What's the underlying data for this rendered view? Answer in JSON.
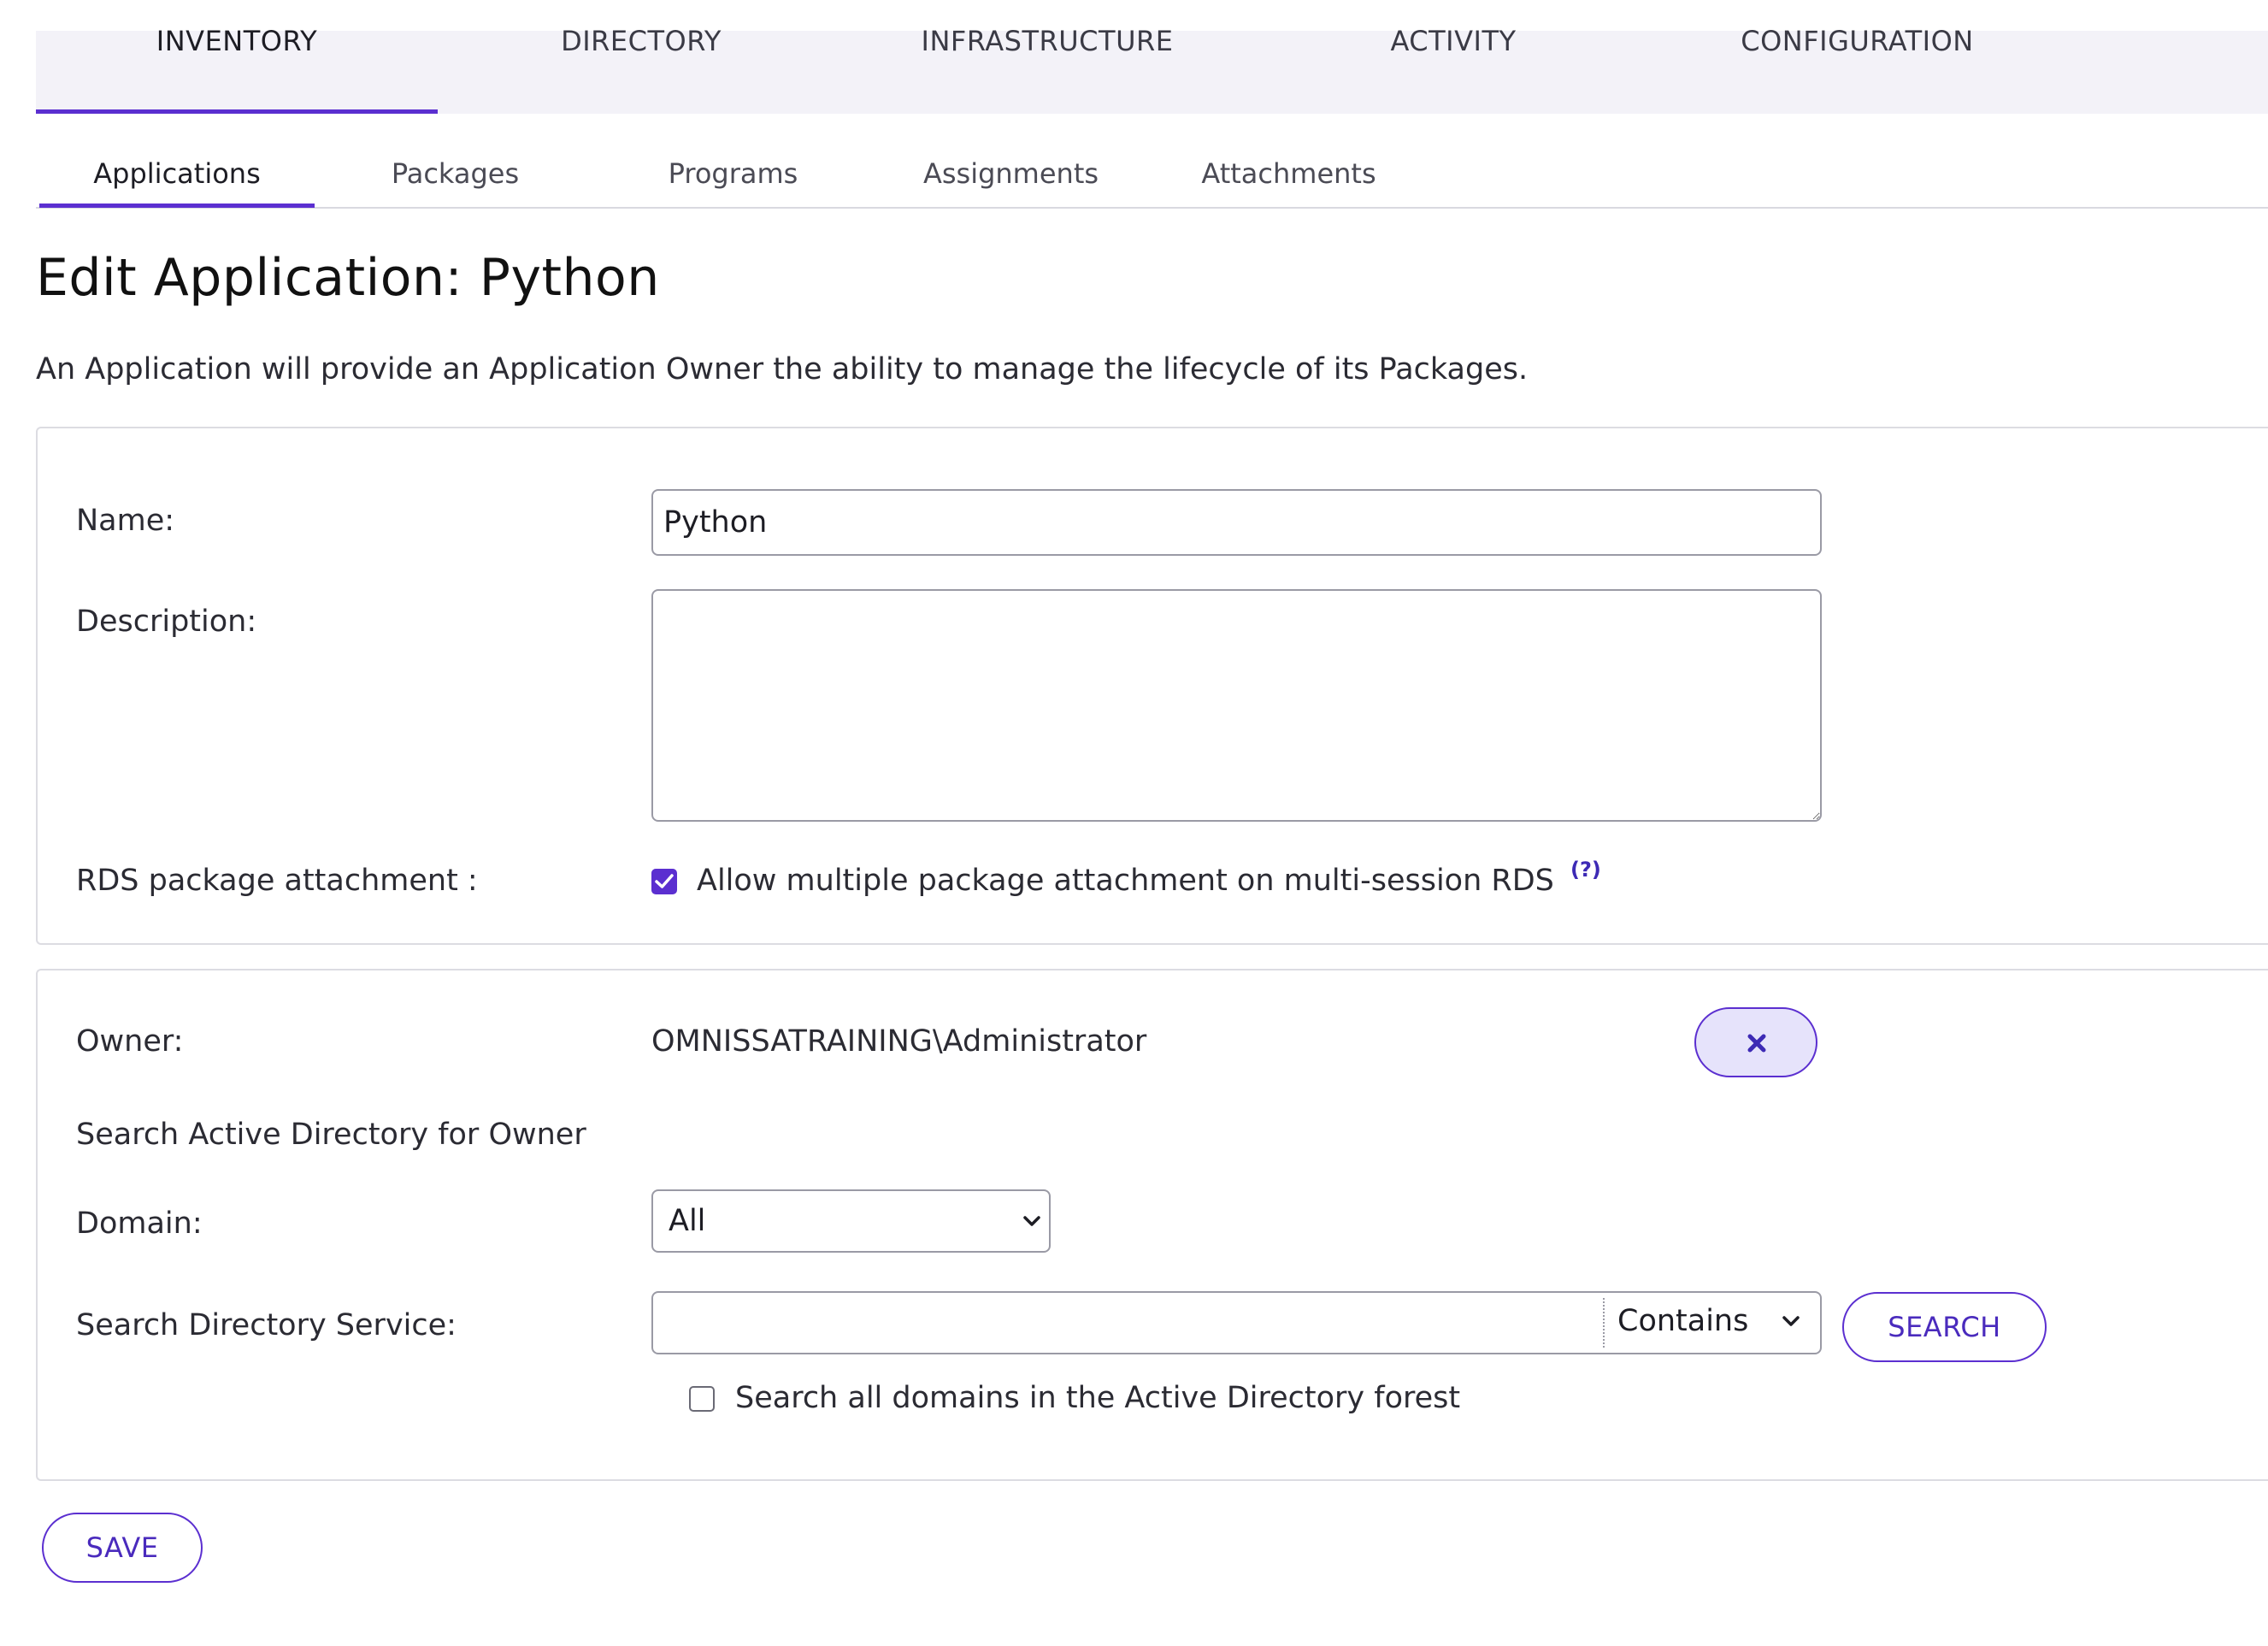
{
  "top_nav": {
    "items": [
      {
        "label": "INVENTORY",
        "active": true
      },
      {
        "label": "DIRECTORY",
        "active": false
      },
      {
        "label": "INFRASTRUCTURE",
        "active": false
      },
      {
        "label": "ACTIVITY",
        "active": false
      },
      {
        "label": "CONFIGURATION",
        "active": false
      }
    ]
  },
  "sub_nav": {
    "items": [
      {
        "label": "Applications",
        "active": true
      },
      {
        "label": "Packages",
        "active": false
      },
      {
        "label": "Programs",
        "active": false
      },
      {
        "label": "Assignments",
        "active": false
      },
      {
        "label": "Attachments",
        "active": false
      }
    ]
  },
  "page": {
    "title": "Edit Application: Python",
    "description": "An Application will provide an Application Owner the ability to manage the lifecycle of its Packages."
  },
  "details_form": {
    "name_label": "Name:",
    "name_value": "Python",
    "description_label": "Description:",
    "description_value": "",
    "rds_label": "RDS package attachment :",
    "rds_checkbox_label": "Allow multiple package attachment on multi-session RDS",
    "rds_checked": true,
    "help_marker": "(?)"
  },
  "owner_form": {
    "owner_label": "Owner:",
    "owner_value": "OMNISSATRAINING\\Administrator",
    "search_heading": "Search Active Directory for Owner",
    "domain_label": "Domain:",
    "domain_value": "All",
    "search_label": "Search Directory Service:",
    "search_value": "",
    "match_mode": "Contains",
    "search_button": "SEARCH",
    "forest_checkbox_label": "Search all domains in the Active Directory forest",
    "forest_checked": false
  },
  "actions": {
    "save_button": "SAVE"
  },
  "colors": {
    "accent": "#5b2fd0",
    "nav_bg": "#f3f2f8"
  }
}
